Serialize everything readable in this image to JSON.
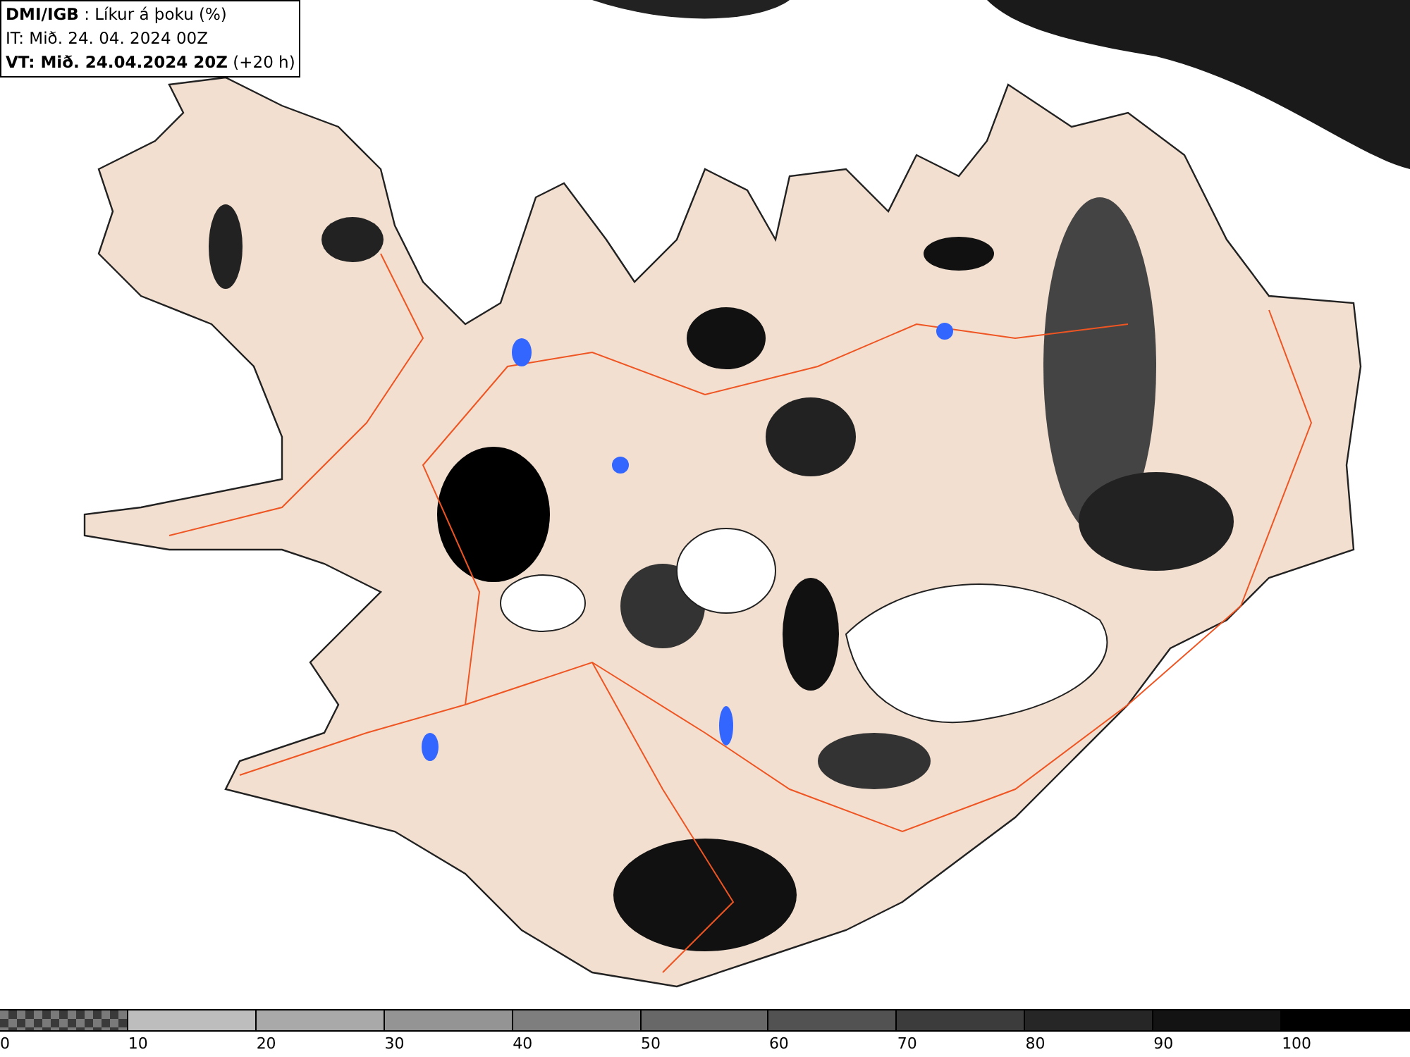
{
  "header": {
    "lines": [
      "**DMI/IGB** : Líkur á þoku (%)",
      "IT: Mið. 24. 04. 2024 00Z",
      "**VT: Mið. 24.04.2024 20Z** (+20 h)"
    ]
  },
  "legend": [
    {
      "kind": "checker",
      "label": "0"
    },
    {
      "kind": "solid",
      "color": "#bdbdbd",
      "label": "10"
    },
    {
      "kind": "solid",
      "color": "#a9a9a9",
      "label": "20"
    },
    {
      "kind": "solid",
      "color": "#949494",
      "label": "30"
    },
    {
      "kind": "solid",
      "color": "#7e7e7e",
      "label": "40"
    },
    {
      "kind": "solid",
      "color": "#686868",
      "label": "50"
    },
    {
      "kind": "solid",
      "color": "#525252",
      "label": "60"
    },
    {
      "kind": "solid",
      "color": "#3c3c3c",
      "label": "70"
    },
    {
      "kind": "solid",
      "color": "#262626",
      "label": "80"
    },
    {
      "kind": "solid",
      "color": "#131313",
      "label": "90"
    },
    {
      "kind": "solid",
      "color": "#000000",
      "label": "100"
    }
  ]
}
